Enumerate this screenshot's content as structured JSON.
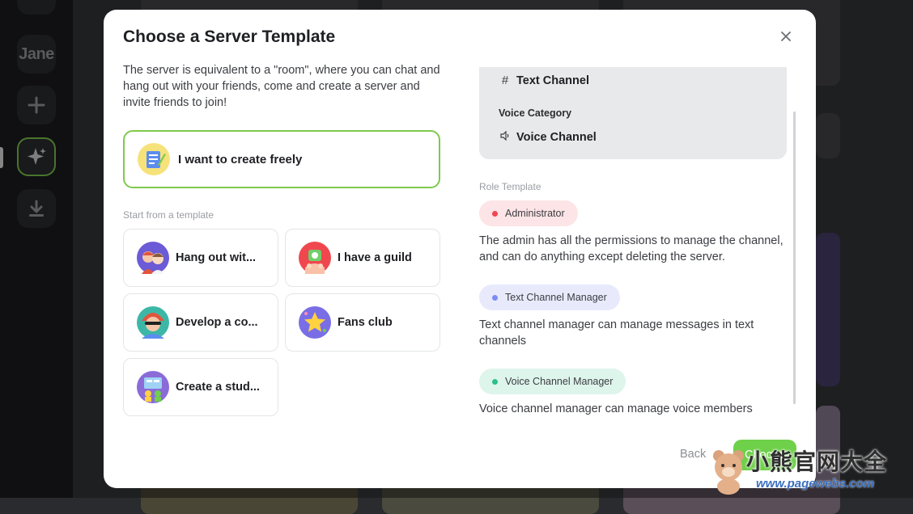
{
  "sidebar": {
    "server_jane": "Jane",
    "add_icon": "plus-icon",
    "discover_icon": "sparkle-icon",
    "download_icon": "download-icon"
  },
  "modal": {
    "title": "Choose a Server Template",
    "intro": "The server is equivalent to a \"room\", where you can chat and hang out with your friends, come and create a server and invite friends to join!",
    "create_freely": "I want to create freely",
    "templates_label": "Start from a template",
    "templates": [
      {
        "label": "Hang out wit...",
        "icon": "friends-icon"
      },
      {
        "label": "I have a guild",
        "icon": "guild-icon"
      },
      {
        "label": "Develop a co...",
        "icon": "community-icon"
      },
      {
        "label": "Fans club",
        "icon": "star-icon"
      },
      {
        "label": "Create a stud...",
        "icon": "study-icon"
      }
    ],
    "channels": {
      "text_channel": "Text Channel",
      "voice_category": "Voice Category",
      "voice_channel": "Voice Channel"
    },
    "role_template_label": "Role Template",
    "roles": [
      {
        "name": "Administrator",
        "dot_color": "#f0474f",
        "bg_color": "#fde4e6",
        "description": "The admin has all the permissions to manage the channel, and can do anything except deleting the server."
      },
      {
        "name": "Text Channel Manager",
        "dot_color": "#7b8cf2",
        "bg_color": "#e8eafc",
        "description": "Text channel manager can manage messages in text channels"
      },
      {
        "name": "Voice Channel Manager",
        "dot_color": "#2bbf8e",
        "bg_color": "#def5ec",
        "description": "Voice channel manager can manage voice members"
      }
    ],
    "back": "Back",
    "choose": "Choose"
  },
  "watermark": {
    "text": "小熊官网大全",
    "url": "www.pagewebs.com"
  },
  "colors": {
    "accent": "#7ec94d",
    "primary_button": "#6fd04a"
  }
}
